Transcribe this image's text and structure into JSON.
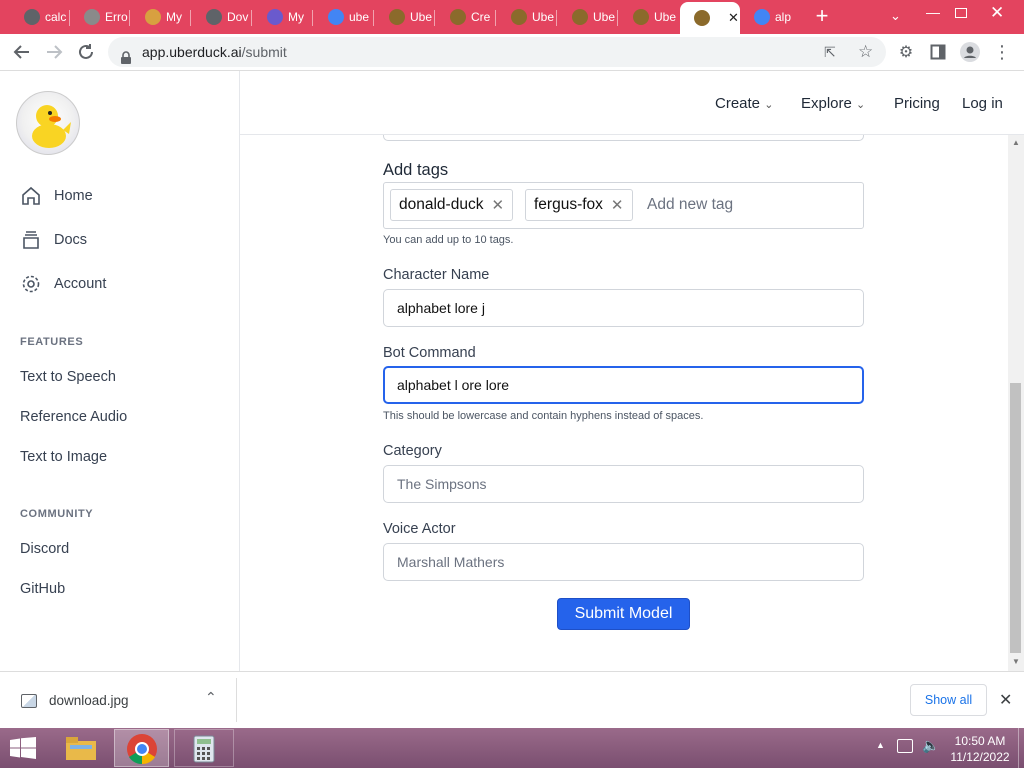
{
  "browser": {
    "tabs": [
      {
        "label": "calc",
        "color": "#5f6368"
      },
      {
        "label": "Erro",
        "color": "#8a8a8a"
      },
      {
        "label": "My",
        "color": "#d8a040"
      },
      {
        "label": "Dov",
        "color": "#5f6368"
      },
      {
        "label": "My",
        "color": "#6a5acd"
      },
      {
        "label": "ube",
        "color": "#4285f4"
      },
      {
        "label": "Ube",
        "color": "#8b6a2b"
      },
      {
        "label": "Cre",
        "color": "#8b6a2b"
      },
      {
        "label": "Ube",
        "color": "#8b6a2b"
      },
      {
        "label": "Ube",
        "color": "#8b6a2b"
      },
      {
        "label": "Ube",
        "color": "#8b6a2b"
      },
      {
        "label": "",
        "color": "#8b6a2b"
      },
      {
        "label": "alp",
        "color": "#4285f4"
      }
    ],
    "url_host": "app.uberduck.ai",
    "url_path": "/submit"
  },
  "nav": {
    "create": "Create",
    "explore": "Explore",
    "pricing": "Pricing",
    "login": "Log in"
  },
  "sidebar": {
    "home": "Home",
    "docs": "Docs",
    "account": "Account",
    "features_heading": "FEATURES",
    "features": [
      "Text to Speech",
      "Reference Audio",
      "Text to Image"
    ],
    "community_heading": "COMMUNITY",
    "community": [
      "Discord",
      "GitHub"
    ]
  },
  "form": {
    "tags_label": "Add tags",
    "tags": [
      "donald-duck",
      "fergus-fox"
    ],
    "tag_placeholder": "Add new tag",
    "tags_hint": "You can add up to 10 tags.",
    "character_label": "Character Name",
    "character_value": "alphabet lore j",
    "bot_label": "Bot Command",
    "bot_value": "alphabet l ore lore",
    "bot_hint": "This should be lowercase and contain hyphens instead of spaces.",
    "category_label": "Category",
    "category_placeholder": "The Simpsons",
    "voice_label": "Voice Actor",
    "voice_placeholder": "Marshall Mathers",
    "submit_label": "Submit Model"
  },
  "downloads": {
    "file": "download.jpg",
    "show_all": "Show all"
  },
  "taskbar": {
    "time": "10:50 AM",
    "date": "11/12/2022"
  },
  "colors": {
    "tabstrip": "#e3445f",
    "accent": "#2563eb"
  }
}
